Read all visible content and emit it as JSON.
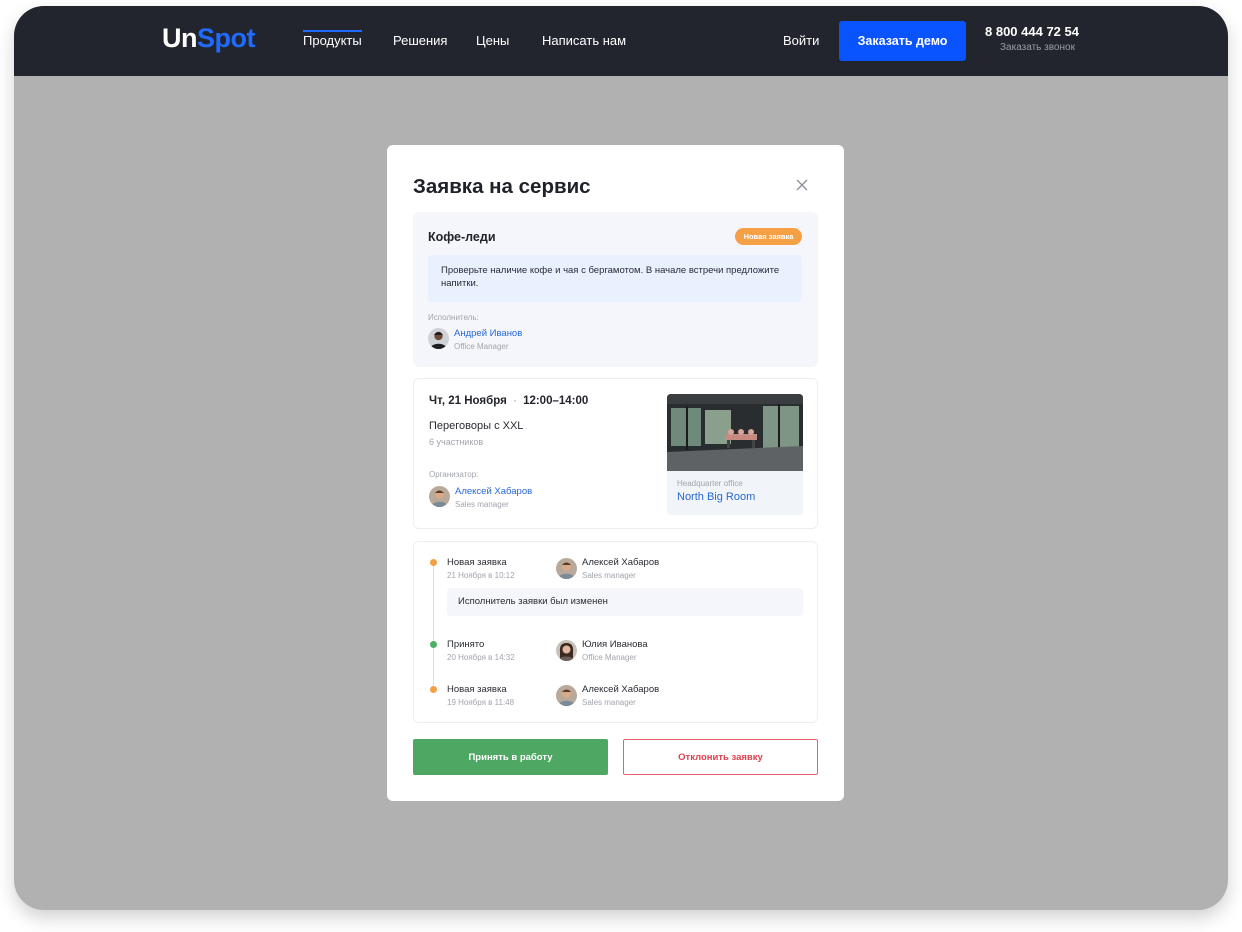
{
  "nav": {
    "logo_part1": "Un",
    "logo_part2": "Spot",
    "links": [
      "Продукты",
      "Решения",
      "Цены",
      "Написать нам"
    ],
    "login": "Войти",
    "demo_button": "Заказать демо",
    "phone": "8 800 444 72 54",
    "callback": "Заказать звонок"
  },
  "modal": {
    "title": "Заявка на сервис",
    "request": {
      "title": "Кофе-леди",
      "badge": "Новая заявка",
      "note": "Проверьте наличие кофе и чая с бергамотом. В начале встречи предложите напитки.",
      "assignee_label": "Исполнитель:",
      "assignee_name": "Андрей Иванов",
      "assignee_role": "Office Manager"
    },
    "meeting": {
      "day": "Чт, 21 Ноября",
      "separator": "·",
      "time": "12:00–14:00",
      "title": "Переговоры с XXL",
      "participants": "6 участников",
      "organizer_label": "Организатор:",
      "organizer_name": "Алексей Хабаров",
      "organizer_role": "Sales manager",
      "room_office": "Headquarter office",
      "room_name": "North Big Room"
    },
    "history": [
      {
        "status": "Новая заявка",
        "date": "21 Ноября в 10:12",
        "person": "Алексей Хабаров",
        "role": "Sales manager",
        "dot": "#f6a046"
      },
      {
        "status": "Принято",
        "date": "20 Ноября в 14:32",
        "person": "Юлия Иванова",
        "role": "Office Manager",
        "dot": "#4caf62"
      },
      {
        "status": "Новая заявка",
        "date": "19 Ноября в 11:48",
        "person": "Алексей Хабаров",
        "role": "Sales manager",
        "dot": "#f6a046"
      }
    ],
    "history_note": "Исполнитель заявки был изменен",
    "accept_button": "Принять в работу",
    "reject_button": "Отклонить заявку"
  },
  "colors": {
    "brand_blue": "#0a54ff",
    "nav_bg": "#23252e",
    "accept_green": "#4ea762",
    "reject_red": "#e0404f",
    "badge_orange": "#f6a046",
    "overlay": "#b1b1b1"
  },
  "icons": {
    "close": "close-icon"
  }
}
